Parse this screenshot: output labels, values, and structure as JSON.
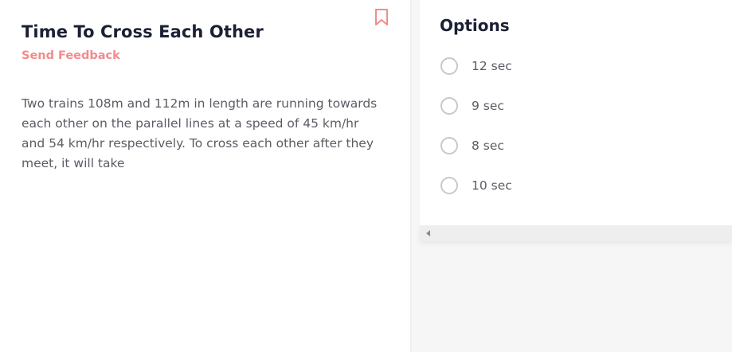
{
  "question": {
    "title": "Time To Cross Each Other",
    "feedback_label": "Send Feedback",
    "text": "Two trains 108m and 112m in length are running towards each other on the parallel lines at a speed of 45 km/hr and 54 km/hr respectively. To cross each other after they meet, it will take",
    "bookmark_icon": "bookmark-icon",
    "colors": {
      "title": "#1b2034",
      "feedback": "#f28b8d",
      "bookmark": "#f28b8d",
      "body_text": "#5a5d64"
    }
  },
  "options": {
    "title": "Options",
    "items": [
      {
        "label": "12 sec"
      },
      {
        "label": "9 sec"
      },
      {
        "label": "8 sec"
      },
      {
        "label": "10 sec"
      }
    ]
  }
}
